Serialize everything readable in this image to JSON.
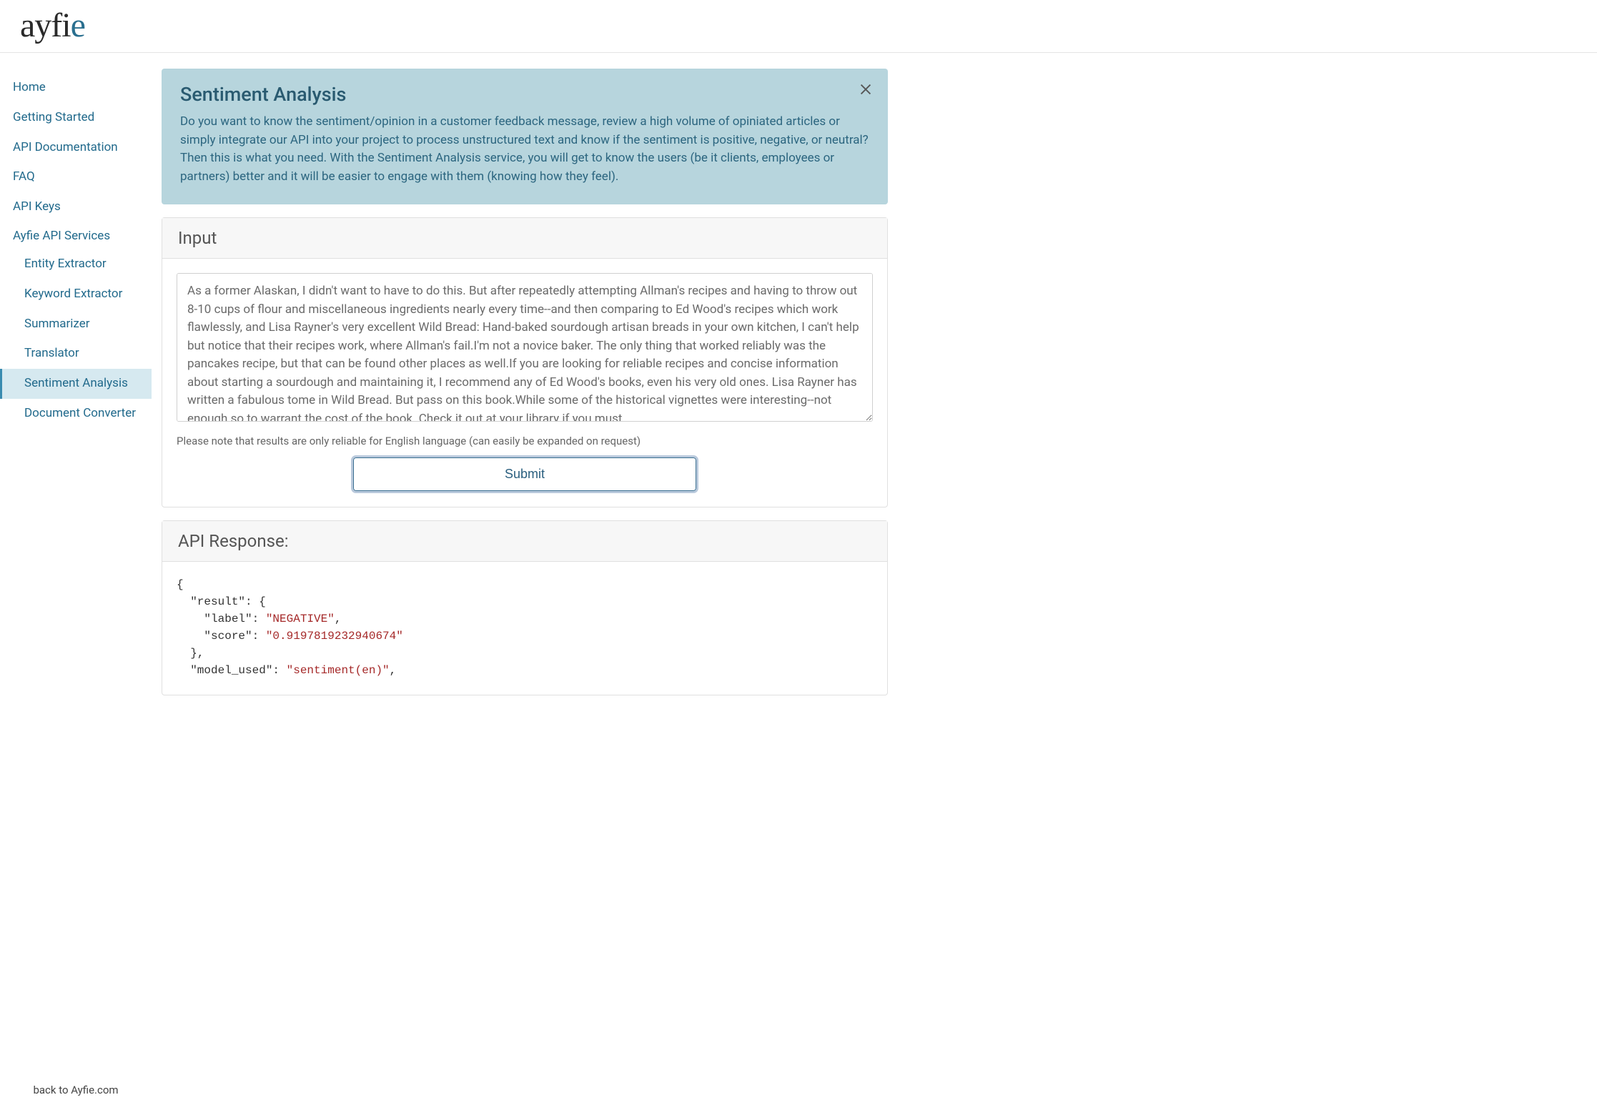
{
  "logo": {
    "text_main": "ayfi",
    "text_accent": "e"
  },
  "sidebar": {
    "items": [
      {
        "label": "Home"
      },
      {
        "label": "Getting Started"
      },
      {
        "label": "API Documentation"
      },
      {
        "label": "FAQ"
      },
      {
        "label": "API Keys"
      }
    ],
    "section_label": "Ayfie API Services",
    "sub_items": [
      {
        "label": "Entity Extractor"
      },
      {
        "label": "Keyword Extractor"
      },
      {
        "label": "Summarizer"
      },
      {
        "label": "Translator"
      },
      {
        "label": "Sentiment Analysis"
      },
      {
        "label": "Document Converter"
      }
    ],
    "back_link": "back to Ayfie.com"
  },
  "hero": {
    "title": "Sentiment Analysis",
    "description": "Do you want to know the sentiment/opinion in a customer feedback message, review a high volume of opiniated articles or simply integrate our API into your project to process unstructured text and know if the sentiment is positive, negative, or neutral? Then this is what you need. With the Sentiment Analysis service, you will get to know the users (be it clients, employees or partners) better and it will be easier to engage with them (knowing how they feel)."
  },
  "input_card": {
    "header": "Input",
    "textarea_value": "As a former Alaskan, I didn't want to have to do this. But after repeatedly attempting Allman's recipes and having to throw out 8-10 cups of flour and miscellaneous ingredients nearly every time--and then comparing to Ed Wood's recipes which work flawlessly, and Lisa Rayner's very excellent Wild Bread: Hand-baked sourdough artisan breads in your own kitchen, I can't help but notice that their recipes work, where Allman's fail.I'm not a novice baker. The only thing that worked reliably was the pancakes recipe, but that can be found other places as well.If you are looking for reliable recipes and concise information about starting a sourdough and maintaining it, I recommend any of Ed Wood's books, even his very old ones. Lisa Rayner has written a fabulous tome in Wild Bread. But pass on this book.While some of the historical vignettes were interesting--not enough so to warrant the cost of the book. Check it out at your library if you must.",
    "note": "Please note that results are only reliable for English language (can easily be expanded on request)",
    "submit_label": "Submit"
  },
  "response_card": {
    "header": "API Response:",
    "json": {
      "k_result": "\"result\"",
      "k_label": "\"label\"",
      "v_label": "\"NEGATIVE\"",
      "k_score": "\"score\"",
      "v_score": "\"0.9197819232940674\"",
      "k_model": "\"model_used\"",
      "v_model": "\"sentiment(en)\""
    }
  }
}
